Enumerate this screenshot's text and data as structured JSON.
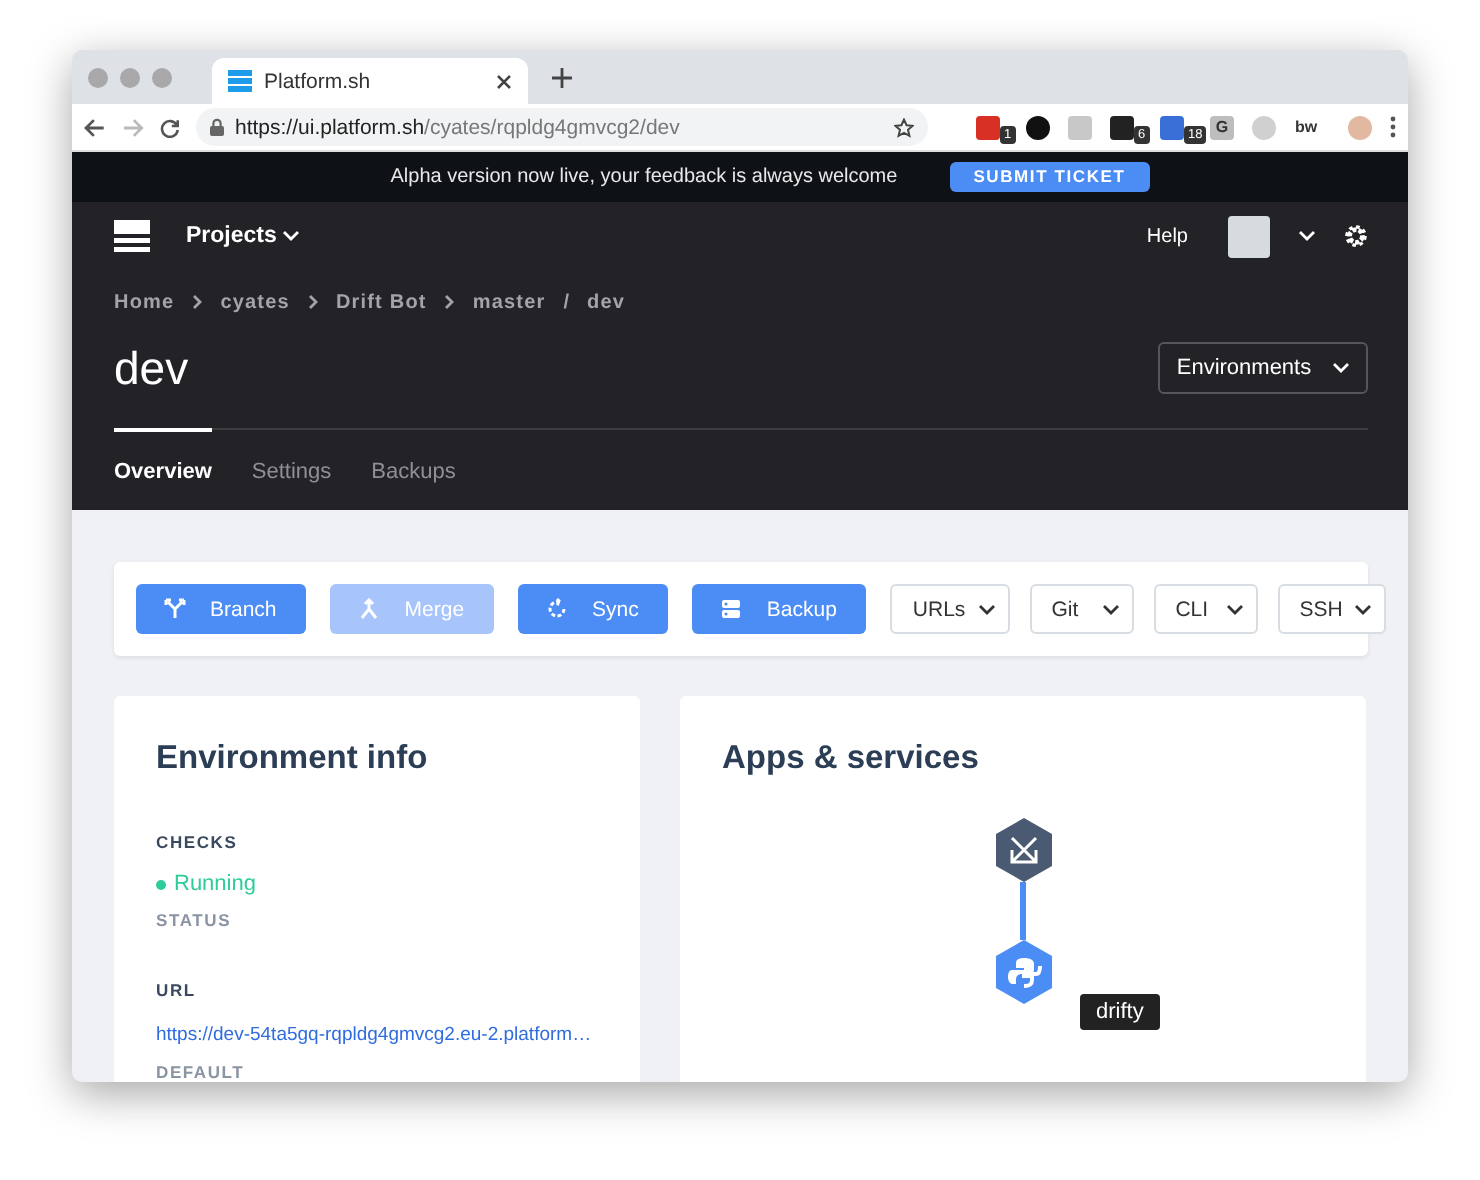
{
  "browser": {
    "tab_title": "Platform.sh",
    "url_host": "https://ui.platform.sh",
    "url_path": "/cyates/rqpldg4gmvcg2/dev",
    "extensions": [
      {
        "kind": "badge",
        "label": "1",
        "color": "#d93025"
      },
      {
        "kind": "round",
        "color": "#111111"
      },
      {
        "kind": "plain",
        "color": "#c8c8c8"
      },
      {
        "kind": "badge",
        "label": "6",
        "color": "#222222"
      },
      {
        "kind": "badge",
        "label": "18",
        "color": "#3b6fd8"
      },
      {
        "kind": "letter",
        "label": "G",
        "color": "#bdbdbd"
      },
      {
        "kind": "round",
        "color": "#d0d0d0"
      },
      {
        "kind": "letter",
        "label": "bw",
        "color": "#ffffff"
      }
    ]
  },
  "banner": {
    "text": "Alpha version now live, your feedback is always welcome",
    "button": "SUBMIT TICKET"
  },
  "nav": {
    "projects": "Projects",
    "help": "Help"
  },
  "breadcrumb": [
    {
      "kind": "link",
      "label": "Home"
    },
    {
      "kind": "chevron"
    },
    {
      "kind": "link",
      "label": "cyates"
    },
    {
      "kind": "chevron"
    },
    {
      "kind": "link",
      "label": "Drift Bot"
    },
    {
      "kind": "chevron"
    },
    {
      "kind": "link",
      "label": "master"
    },
    {
      "kind": "text",
      "label": "/"
    },
    {
      "kind": "link",
      "label": "dev"
    }
  ],
  "title": "dev",
  "environments_button": "Environments",
  "tabs": [
    {
      "label": "Overview",
      "selected": true
    },
    {
      "label": "Settings",
      "selected": false
    },
    {
      "label": "Backups",
      "selected": false
    }
  ],
  "actions": [
    {
      "kind": "branch",
      "label": "Branch",
      "disabled": false
    },
    {
      "kind": "merge",
      "label": "Merge",
      "disabled": true
    },
    {
      "kind": "sync",
      "label": "Sync",
      "disabled": false
    },
    {
      "kind": "backup",
      "label": "Backup",
      "disabled": false
    }
  ],
  "dropdowns": [
    "URLs",
    "Git",
    "CLI",
    "SSH"
  ],
  "environment_info": {
    "title": "Environment info",
    "checks_label": "CHECKS",
    "status": {
      "text": "Running",
      "color": "#2ecc9a"
    },
    "status_label": "STATUS",
    "url_label": "URL",
    "url": "https://dev-54ta5gq-rqpldg4gmvcg2.eu-2.platform…",
    "url_caption": "DEFAULT"
  },
  "apps": {
    "title": "Apps & services",
    "nodes": [
      {
        "kind": "router"
      },
      {
        "kind": "python",
        "tooltip": "drifty"
      }
    ]
  }
}
